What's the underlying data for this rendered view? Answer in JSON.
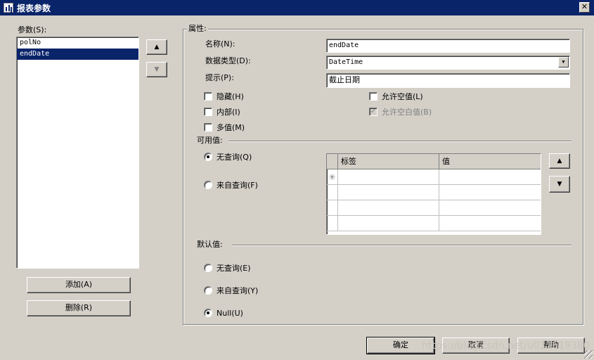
{
  "window": {
    "title": "报表参数",
    "close_glyph": "✕"
  },
  "params": {
    "label": "参数(S):",
    "items": [
      "polNo",
      "endDate"
    ],
    "add_label": "添加(A)",
    "delete_label": "删除(R)"
  },
  "properties": {
    "group_title": "属性:",
    "name_label": "名称(N):",
    "name_value": "endDate",
    "datatype_label": "数据类型(D):",
    "datatype_value": "DateTime",
    "prompt_label": "提示(P):",
    "prompt_value": "截止日期",
    "checkboxes": {
      "hidden": "隐藏(H)",
      "internal": "内部(I)",
      "multivalue": "多值(M)",
      "allow_null": "允许空值(L)",
      "allow_blank": "允许空白值(B)"
    },
    "allow_blank_checked": true
  },
  "available_values": {
    "label": "可用值:",
    "no_query": "无查询(Q)",
    "from_query": "来自查询(F)",
    "selected": "no_query",
    "grid_columns": [
      "标签",
      "值"
    ],
    "new_row_glyph": "✳"
  },
  "default_values": {
    "label": "默认值:",
    "no_query": "无查询(E)",
    "from_query": "来自查询(Y)",
    "null": "Null(U)",
    "selected": "null"
  },
  "footer": {
    "ok": "确定",
    "cancel": "取消",
    "help": "帮助"
  },
  "watermark": "https://blog.csdn.net/u011619380",
  "icons": {
    "up": "▲",
    "down": "▼",
    "dropdown": "▼"
  }
}
